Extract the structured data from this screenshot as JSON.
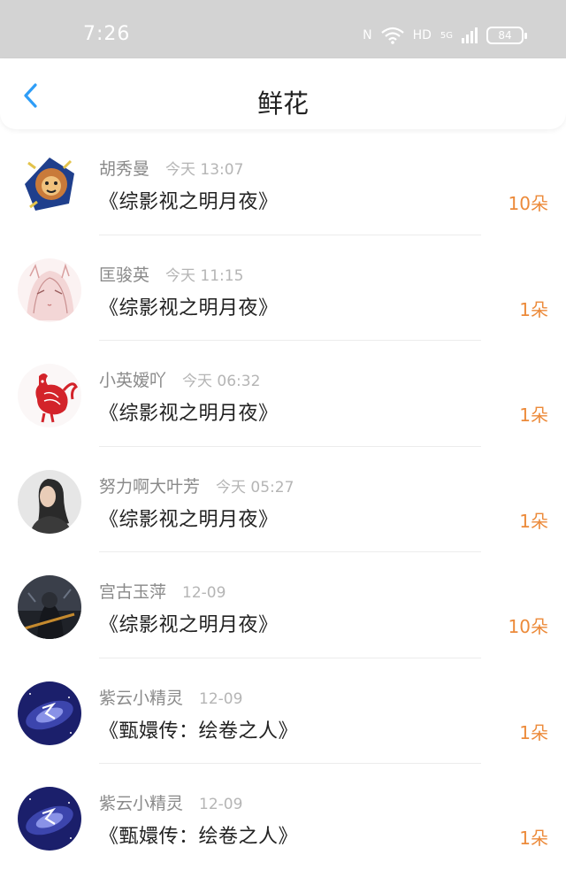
{
  "status_bar": {
    "time": "7:26",
    "nfc": "N",
    "hd": "HD",
    "network": "5G",
    "battery": "84"
  },
  "header": {
    "title": "鲜花"
  },
  "colors": {
    "accent": "#2e9df7",
    "amount": "#ec8a3a"
  },
  "records": [
    {
      "user": "胡秀曼",
      "time": "今天 13:07",
      "book": "《综影视之明月夜》",
      "amount": "10朵",
      "avatar": "lion-avatar"
    },
    {
      "user": "匡骏英",
      "time": "今天 11:15",
      "book": "《综影视之明月夜》",
      "amount": "1朵",
      "avatar": "anime-girl-avatar"
    },
    {
      "user": "小英嫒吖",
      "time": "今天 06:32",
      "book": "《综影视之明月夜》",
      "amount": "1朵",
      "avatar": "rooster-avatar"
    },
    {
      "user": "努力啊大叶芳",
      "time": "今天 05:27",
      "book": "《综影视之明月夜》",
      "amount": "1朵",
      "avatar": "woman-photo-avatar"
    },
    {
      "user": "宫古玉萍",
      "time": "12-09",
      "book": "《综影视之明月夜》",
      "amount": "10朵",
      "avatar": "dark-warrior-avatar"
    },
    {
      "user": "紫云小精灵",
      "time": "12-09",
      "book": "《甄嬛传：绘卷之人》",
      "amount": "1朵",
      "avatar": "galaxy-avatar"
    },
    {
      "user": "紫云小精灵",
      "time": "12-09",
      "book": "《甄嬛传：绘卷之人》",
      "amount": "1朵",
      "avatar": "galaxy-avatar"
    }
  ]
}
